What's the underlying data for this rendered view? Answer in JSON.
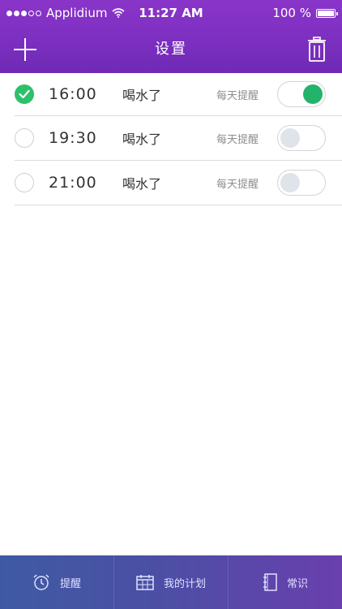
{
  "status_bar": {
    "carrier": "Applidium",
    "time": "11:27 AM",
    "battery": "100 %"
  },
  "nav": {
    "title": "设置"
  },
  "reminders": [
    {
      "time": "16:00",
      "label": "喝水了",
      "repeat": "每天提醒",
      "checked": true,
      "enabled": true
    },
    {
      "time": "19:30",
      "label": "喝水了",
      "repeat": "每天提醒",
      "checked": false,
      "enabled": false
    },
    {
      "time": "21:00",
      "label": "喝水了",
      "repeat": "每天提醒",
      "checked": false,
      "enabled": false
    }
  ],
  "tabs": [
    {
      "label": "提醒",
      "icon": "alarm-clock-icon"
    },
    {
      "label": "我的计划",
      "icon": "calendar-icon"
    },
    {
      "label": "常识",
      "icon": "notebook-icon"
    }
  ],
  "colors": {
    "header": "#7c2fc0",
    "accent_green": "#22b46a",
    "tabbar": "#4b4fa4"
  }
}
